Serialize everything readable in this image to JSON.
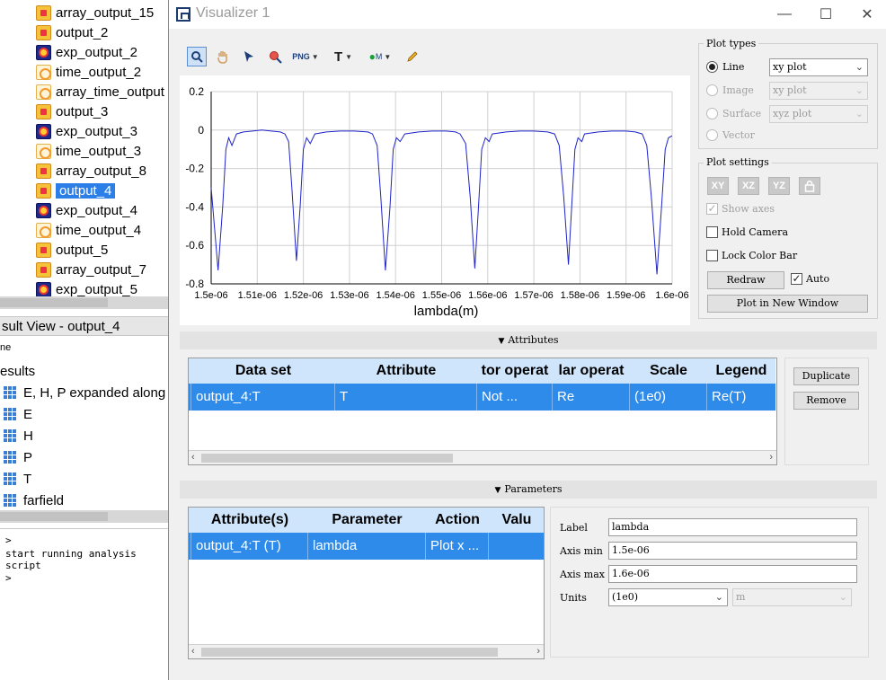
{
  "left_tree": {
    "items": [
      {
        "label": "array_output_15",
        "icon": "array-icon"
      },
      {
        "label": "output_2",
        "icon": "array-icon"
      },
      {
        "label": "exp_output_2",
        "icon": "exp-icon"
      },
      {
        "label": "time_output_2",
        "icon": "time-icon"
      },
      {
        "label": "array_time_output",
        "icon": "time-icon"
      },
      {
        "label": "output_3",
        "icon": "array-icon"
      },
      {
        "label": "exp_output_3",
        "icon": "exp-icon"
      },
      {
        "label": "time_output_3",
        "icon": "time-icon"
      },
      {
        "label": "array_output_8",
        "icon": "array-icon"
      },
      {
        "label": "output_4",
        "icon": "array-icon",
        "selected": true
      },
      {
        "label": "exp_output_4",
        "icon": "exp-icon"
      },
      {
        "label": "time_output_4",
        "icon": "time-icon"
      },
      {
        "label": "output_5",
        "icon": "array-icon"
      },
      {
        "label": "array_output_7",
        "icon": "array-icon"
      },
      {
        "label": "exp_output_5",
        "icon": "exp-icon"
      }
    ]
  },
  "result_view": {
    "header": "sult View - output_4",
    "name_col": "ne",
    "results_label": "esults",
    "items": [
      "E, H, P expanded along",
      "E",
      "H",
      "P",
      "T",
      "farfield"
    ]
  },
  "console": {
    "prompt1": ">",
    "line": "start running analysis script",
    "prompt2": ">"
  },
  "window": {
    "title": "Visualizer 1",
    "minimize": "—",
    "maximize": "☐",
    "close": "✕"
  },
  "toolbar": {
    "tools": [
      "zoom-tool",
      "pan-tool",
      "select-tool",
      "zoom-region-tool",
      "export-png-tool",
      "text-tool",
      "marker-tool",
      "pencil-tool"
    ],
    "png_label": "PNG",
    "text_label": "T",
    "marker_label": "M"
  },
  "chart_data": {
    "type": "line",
    "xlabel": "lambda(m)",
    "ylabel": "",
    "title": "",
    "xlim": [
      1.5e-06,
      1.6e-06
    ],
    "ylim": [
      -0.8,
      0.2
    ],
    "x_ticks": [
      "1.5e-06",
      "1.51e-06",
      "1.52e-06",
      "1.53e-06",
      "1.54e-06",
      "1.55e-06",
      "1.56e-06",
      "1.57e-06",
      "1.58e-06",
      "1.59e-06",
      "1.6e-06"
    ],
    "y_ticks": [
      "0.2",
      "0",
      "-0.2",
      "-0.4",
      "-0.6",
      "-0.8"
    ],
    "grid": true,
    "color": "#1f24c8",
    "series": [
      {
        "points": [
          [
            1.5e-06,
            -0.3
          ],
          [
            1.5015e-06,
            -0.73
          ],
          [
            1.5025e-06,
            -0.4
          ],
          [
            1.5032e-06,
            -0.1
          ],
          [
            1.5038e-06,
            -0.04
          ],
          [
            1.5045e-06,
            -0.08
          ],
          [
            1.5055e-06,
            -0.02
          ],
          [
            1.507e-06,
            -0.01
          ],
          [
            1.509e-06,
            -0.005
          ],
          [
            1.511e-06,
            0.0
          ],
          [
            1.513e-06,
            -0.005
          ],
          [
            1.515e-06,
            -0.01
          ],
          [
            1.516e-06,
            -0.02
          ],
          [
            1.5168e-06,
            -0.06
          ],
          [
            1.5175e-06,
            -0.3
          ],
          [
            1.5185e-06,
            -0.68
          ],
          [
            1.5193e-06,
            -0.4
          ],
          [
            1.52e-06,
            -0.1
          ],
          [
            1.5207e-06,
            -0.04
          ],
          [
            1.5215e-06,
            -0.07
          ],
          [
            1.5225e-06,
            -0.02
          ],
          [
            1.525e-06,
            -0.01
          ],
          [
            1.528e-06,
            -0.005
          ],
          [
            1.531e-06,
            -0.005
          ],
          [
            1.534e-06,
            -0.01
          ],
          [
            1.535e-06,
            -0.02
          ],
          [
            1.536e-06,
            -0.08
          ],
          [
            1.5368e-06,
            -0.35
          ],
          [
            1.5378e-06,
            -0.73
          ],
          [
            1.5388e-06,
            -0.4
          ],
          [
            1.5395e-06,
            -0.1
          ],
          [
            1.5402e-06,
            -0.04
          ],
          [
            1.541e-06,
            -0.06
          ],
          [
            1.542e-06,
            -0.02
          ],
          [
            1.545e-06,
            -0.01
          ],
          [
            1.548e-06,
            -0.005
          ],
          [
            1.551e-06,
            -0.005
          ],
          [
            1.553e-06,
            -0.01
          ],
          [
            1.554e-06,
            -0.02
          ],
          [
            1.5552e-06,
            -0.07
          ],
          [
            1.5562e-06,
            -0.35
          ],
          [
            1.5572e-06,
            -0.72
          ],
          [
            1.558e-06,
            -0.4
          ],
          [
            1.5587e-06,
            -0.1
          ],
          [
            1.5595e-06,
            -0.04
          ],
          [
            1.5603e-06,
            -0.06
          ],
          [
            1.561e-06,
            -0.02
          ],
          [
            1.564e-06,
            -0.01
          ],
          [
            1.567e-06,
            -0.005
          ],
          [
            1.57e-06,
            -0.005
          ],
          [
            1.573e-06,
            -0.01
          ],
          [
            1.5745e-06,
            -0.02
          ],
          [
            1.5755e-06,
            -0.08
          ],
          [
            1.5765e-06,
            -0.35
          ],
          [
            1.5775e-06,
            -0.7
          ],
          [
            1.5782e-06,
            -0.4
          ],
          [
            1.5789e-06,
            -0.1
          ],
          [
            1.5796e-06,
            -0.04
          ],
          [
            1.5804e-06,
            -0.06
          ],
          [
            1.581e-06,
            -0.02
          ],
          [
            1.584e-06,
            -0.01
          ],
          [
            1.587e-06,
            -0.005
          ],
          [
            1.59e-06,
            -0.005
          ],
          [
            1.592e-06,
            -0.01
          ],
          [
            1.5935e-06,
            -0.02
          ],
          [
            1.5945e-06,
            -0.08
          ],
          [
            1.5955e-06,
            -0.35
          ],
          [
            1.5967e-06,
            -0.75
          ],
          [
            1.5977e-06,
            -0.4
          ],
          [
            1.5985e-06,
            -0.1
          ],
          [
            1.5992e-06,
            -0.04
          ],
          [
            1.6e-06,
            -0.03
          ]
        ]
      }
    ]
  },
  "plot_types": {
    "title": "Plot types",
    "options": [
      {
        "label": "Line",
        "checked": true,
        "enabled": true,
        "select": "xy plot"
      },
      {
        "label": "Image",
        "checked": false,
        "enabled": false,
        "select": "xy plot"
      },
      {
        "label": "Surface",
        "checked": false,
        "enabled": false,
        "select": "xyz plot"
      },
      {
        "label": "Vector",
        "checked": false,
        "enabled": false
      }
    ]
  },
  "plot_settings": {
    "title": "Plot settings",
    "axis_buttons": [
      "XY",
      "XZ",
      "YZ"
    ],
    "show_axes": "Show axes",
    "hold_camera": "Hold Camera",
    "lock_color_bar": "Lock Color Bar",
    "redraw": "Redraw",
    "auto": "Auto",
    "plot_new_window": "Plot in New Window"
  },
  "attributes": {
    "section_label": "Attributes",
    "columns": [
      "Data set",
      "Attribute",
      "tor operat",
      "lar operat",
      "Scale",
      "Legend"
    ],
    "rows": [
      [
        "output_4:T",
        "T",
        "Not ...",
        "Re",
        "(1e0)",
        "Re(T)"
      ]
    ],
    "duplicate": "Duplicate",
    "remove": "Remove"
  },
  "parameters": {
    "section_label": "Parameters",
    "columns": [
      "Attribute(s)",
      "Parameter",
      "Action",
      "Valu"
    ],
    "rows": [
      [
        "output_4:T (T)",
        "lambda",
        "Plot x ...",
        ""
      ]
    ],
    "label_label": "Label",
    "label_value": "lambda",
    "axis_min_label": "Axis min",
    "axis_min_value": "1.5e-06",
    "axis_max_label": "Axis max",
    "axis_max_value": "1.6e-06",
    "units_label": "Units",
    "units_value": "(1e0)",
    "units_unit": "m"
  }
}
